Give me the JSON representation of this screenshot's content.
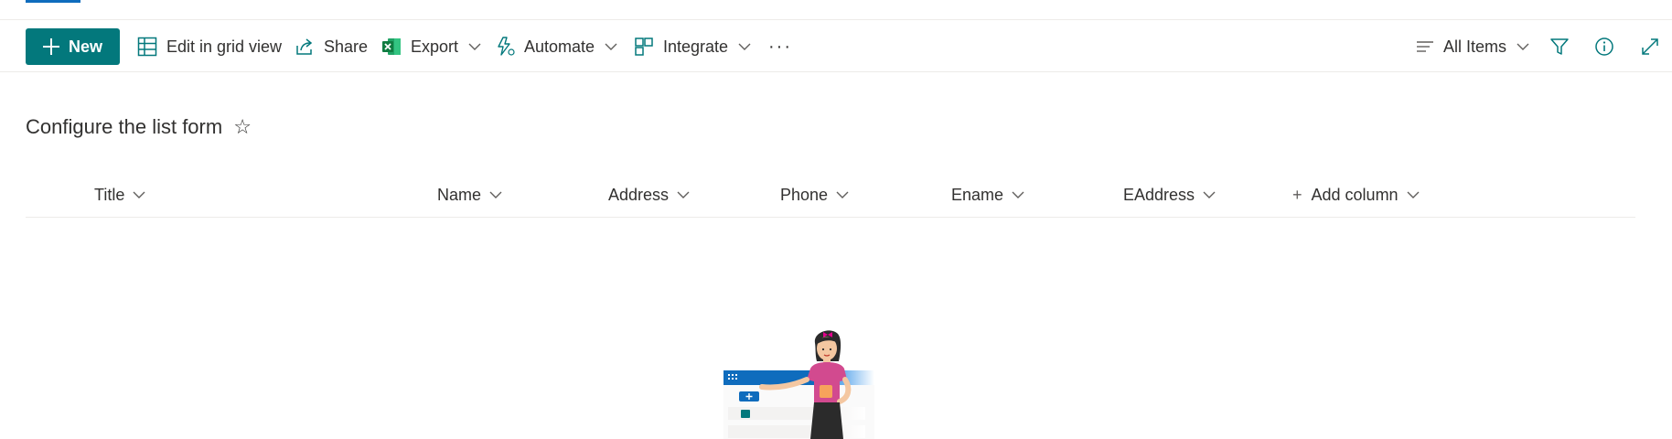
{
  "command_bar": {
    "new_label": "New",
    "edit_grid_label": "Edit in grid view",
    "share_label": "Share",
    "export_label": "Export",
    "automate_label": "Automate",
    "integrate_label": "Integrate",
    "more_label": "···",
    "view_label": "All Items"
  },
  "list": {
    "title": "Configure the list form",
    "star_glyph": "☆"
  },
  "columns": [
    {
      "label": "Title"
    },
    {
      "label": "Name"
    },
    {
      "label": "Address"
    },
    {
      "label": "Phone"
    },
    {
      "label": "Ename"
    },
    {
      "label": "EAddress"
    }
  ],
  "add_column": {
    "plus_glyph": "+",
    "label": "Add column"
  },
  "colors": {
    "accent": "#03787c",
    "excel_green": "#107c41",
    "brand_blue": "#0f6cbd"
  }
}
